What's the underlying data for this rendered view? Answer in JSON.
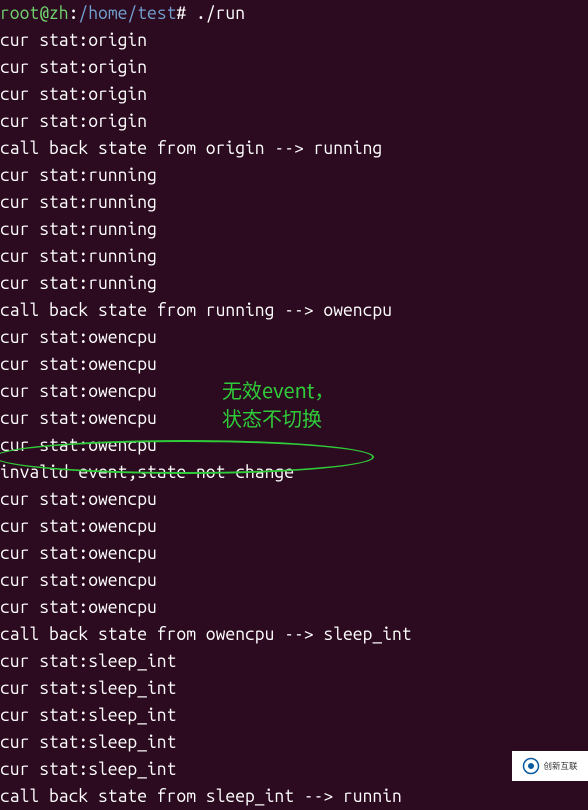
{
  "prompt": {
    "user_host": "root@zh",
    "sep1": ":",
    "path": "/home/test",
    "sep2": "#",
    "command": " ./run"
  },
  "output_lines": [
    "cur stat:origin",
    "cur stat:origin",
    "cur stat:origin",
    "cur stat:origin",
    "call back state from origin --> running",
    "cur stat:running",
    "cur stat:running",
    "cur stat:running",
    "cur stat:running",
    "cur stat:running",
    "call back state from running --> owencpu",
    "cur stat:owencpu",
    "cur stat:owencpu",
    "cur stat:owencpu",
    "cur stat:owencpu",
    "cur stat:owencpu",
    "invalid event,state not change",
    "cur stat:owencpu",
    "cur stat:owencpu",
    "cur stat:owencpu",
    "cur stat:owencpu",
    "cur stat:owencpu",
    "call back state from owencpu --> sleep_int",
    "cur stat:sleep_int",
    "cur stat:sleep_int",
    "cur stat:sleep_int",
    "cur stat:sleep_int",
    "cur stat:sleep_int",
    "call back state from sleep_int --> runnin"
  ],
  "annotation": {
    "line1": "无效event，",
    "line2": "状态不切换"
  },
  "watermark": {
    "brand": "创新互联"
  }
}
